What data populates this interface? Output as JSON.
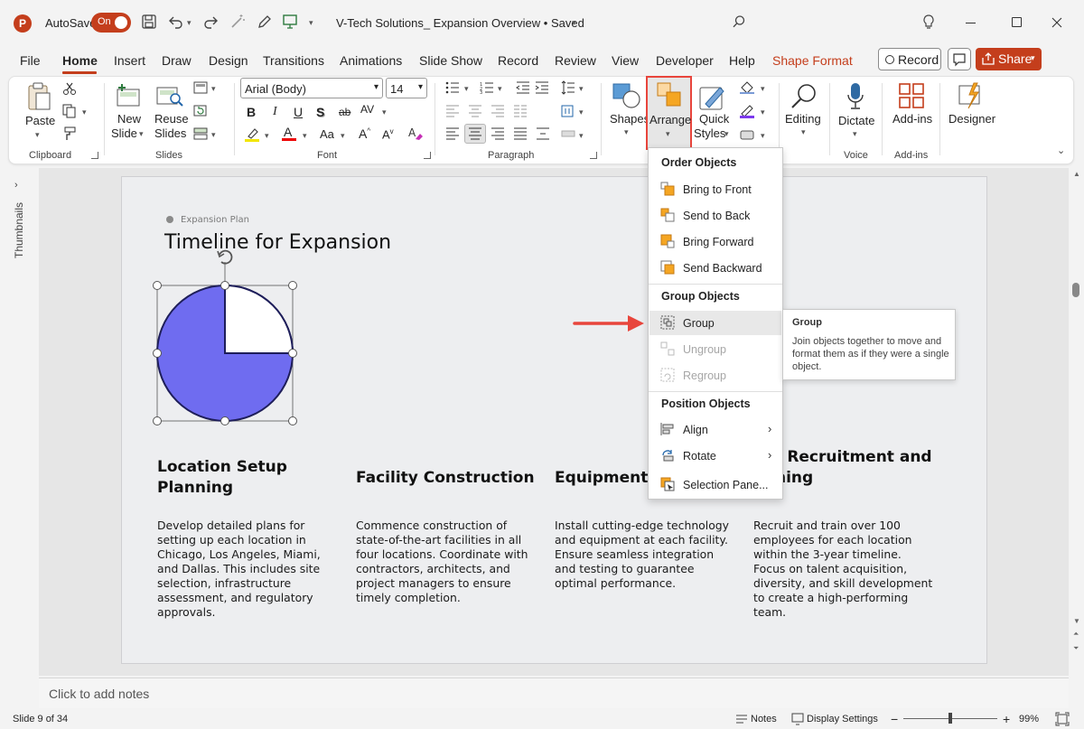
{
  "titlebar": {
    "autosave_label": "AutoSave",
    "autosave_state": "On",
    "document_title": "V-Tech Solutions_ Expansion Overview • Saved",
    "accent_color": "#c43e1c"
  },
  "tabs": [
    {
      "label": "File"
    },
    {
      "label": "Home",
      "active": true
    },
    {
      "label": "Insert"
    },
    {
      "label": "Draw"
    },
    {
      "label": "Design"
    },
    {
      "label": "Transitions"
    },
    {
      "label": "Animations"
    },
    {
      "label": "Slide Show"
    },
    {
      "label": "Record"
    },
    {
      "label": "Review"
    },
    {
      "label": "View"
    },
    {
      "label": "Developer"
    },
    {
      "label": "Help"
    },
    {
      "label": "Shape Format",
      "contextual": true
    }
  ],
  "header_buttons": {
    "record_label": "Record",
    "share_label": "Share"
  },
  "ribbon": {
    "clipboard": {
      "paste_label": "Paste",
      "group_label": "Clipboard"
    },
    "slides": {
      "new_slide_line1": "New",
      "new_slide_line2": "Slide",
      "reuse_line1": "Reuse",
      "reuse_line2": "Slides",
      "group_label": "Slides"
    },
    "font": {
      "font_name": "Arial (Body)",
      "font_size": "14",
      "group_label": "Font"
    },
    "paragraph": {
      "group_label": "Paragraph"
    },
    "drawing": {
      "shapes_label": "Shapes",
      "arrange_label": "Arrange",
      "quick_styles_line1": "Quick",
      "quick_styles_line2": "Styles"
    },
    "editing": {
      "label": "Editing"
    },
    "voice": {
      "dictate_label": "Dictate",
      "group_label": "Voice"
    },
    "addins": {
      "label": "Add-ins",
      "group_label": "Add-ins"
    },
    "designer": {
      "label": "Designer"
    }
  },
  "left_pane": {
    "thumbnails_label": "Thumbnails"
  },
  "slide": {
    "eyebrow": "Expansion Plan",
    "title": "Timeline for Expansion",
    "pie_fill_color": "#6f6cf0",
    "pie_fraction_filled": 0.75,
    "columns": [
      {
        "heading": "Location Setup Planning",
        "body": "Develop detailed plans for setting up each location in Chicago, Los Angeles, Miami, and Dallas. This includes site selection, infrastructure assessment, and regulatory approvals."
      },
      {
        "heading": "Facility Construction",
        "body": "Commence construction of state-of-the-art facilities in all four locations. Coordinate with contractors, architects, and project managers to ensure timely completion."
      },
      {
        "heading": "Equipment In",
        "body": "Install cutting-edge technology and equipment at each facility. Ensure seamless integration and testing to guarantee optimal performance."
      },
      {
        "heading": "f Recruitment and ning",
        "body": "Recruit and train over 100 employees for each location within the 3-year timeline. Focus on talent acquisition, diversity, and skill development to create a high-performing team."
      }
    ]
  },
  "arrange_menu": {
    "order_header": "Order Objects",
    "bring_to_front": "Bring to Front",
    "send_to_back": "Send to Back",
    "bring_forward": "Bring Forward",
    "send_backward": "Send Backward",
    "group_header": "Group Objects",
    "group": "Group",
    "ungroup": "Ungroup",
    "regroup": "Regroup",
    "position_header": "Position Objects",
    "align": "Align",
    "rotate": "Rotate",
    "selection_pane": "Selection Pane..."
  },
  "tooltip": {
    "title": "Group",
    "description": "Join objects together to move and format them as if they were a single object."
  },
  "notes": {
    "placeholder": "Click to add notes"
  },
  "status": {
    "slide_info": "Slide 9 of 34",
    "notes_label": "Notes",
    "display_settings_label": "Display Settings",
    "zoom": "99%"
  },
  "highlight_color": "#e8453c"
}
